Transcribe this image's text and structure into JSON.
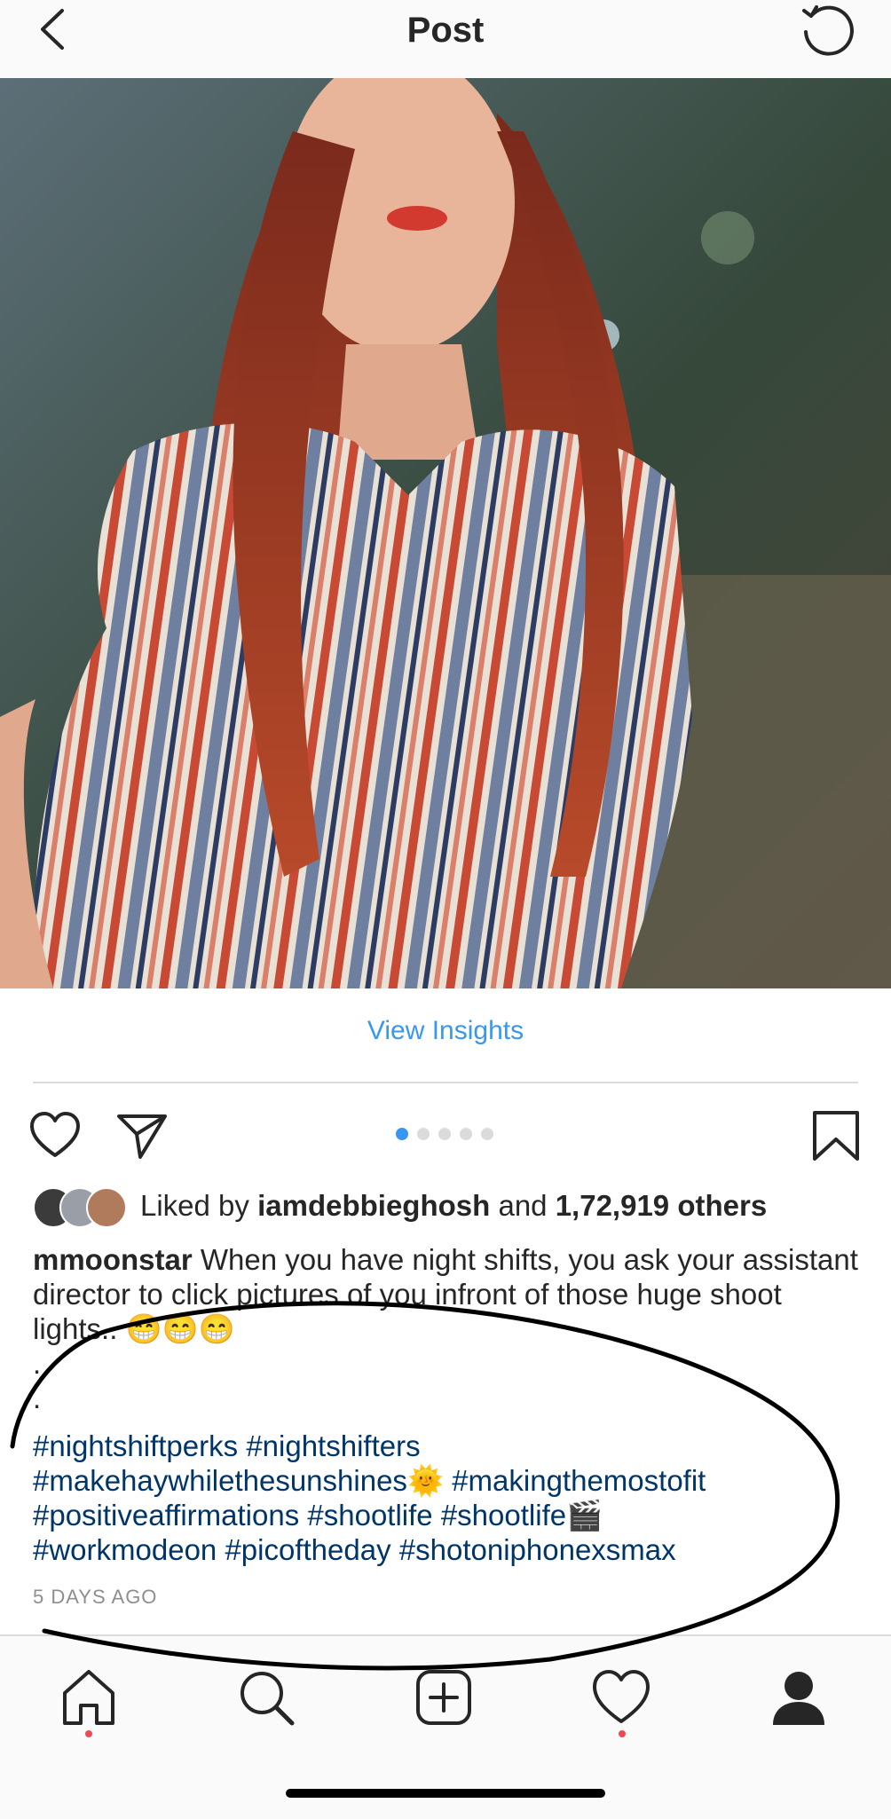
{
  "header": {
    "title": "Post",
    "back_icon": "chevron-left-icon",
    "refresh_icon": "refresh-icon"
  },
  "post": {
    "photo_description": "photo",
    "insights_label": "View Insights",
    "carousel": {
      "count": 5,
      "active_index": 0
    },
    "likes": {
      "prefix": "Liked by",
      "user": "iamdebbieghosh",
      "middle": "and",
      "count_text": "1,72,919 others"
    },
    "caption": {
      "username": "mmoonstar",
      "text": " When you have night shifts, you ask your assistant director to click pictures of you infront of those huge shoot lights.. 😁😁😁",
      "dot1": ".",
      "dot2": "."
    },
    "hashtags": {
      "h1": "#nightshiftperks",
      "h2": "#nightshifters",
      "h3": "#makehaywhilethesunshines",
      "e3": "🌞",
      "h4": "#makingthemostofit",
      "h5": "#positiveaffirmations",
      "h6": "#shootlife",
      "h7": "#shootlife",
      "e7": "🎬",
      "h8": "#workmodeon",
      "h9": "#picoftheday",
      "h10": "#shotoniphonexsmax"
    },
    "timestamp": "5 DAYS AGO"
  },
  "colors": {
    "link_blue": "#3897f0",
    "hashtag_blue": "#003569",
    "notification_red": "#ed4956",
    "muted": "#8e8e8e"
  },
  "tabbar": {
    "items": [
      "home-icon",
      "search-icon",
      "add-icon",
      "heart-icon",
      "profile-icon"
    ]
  }
}
